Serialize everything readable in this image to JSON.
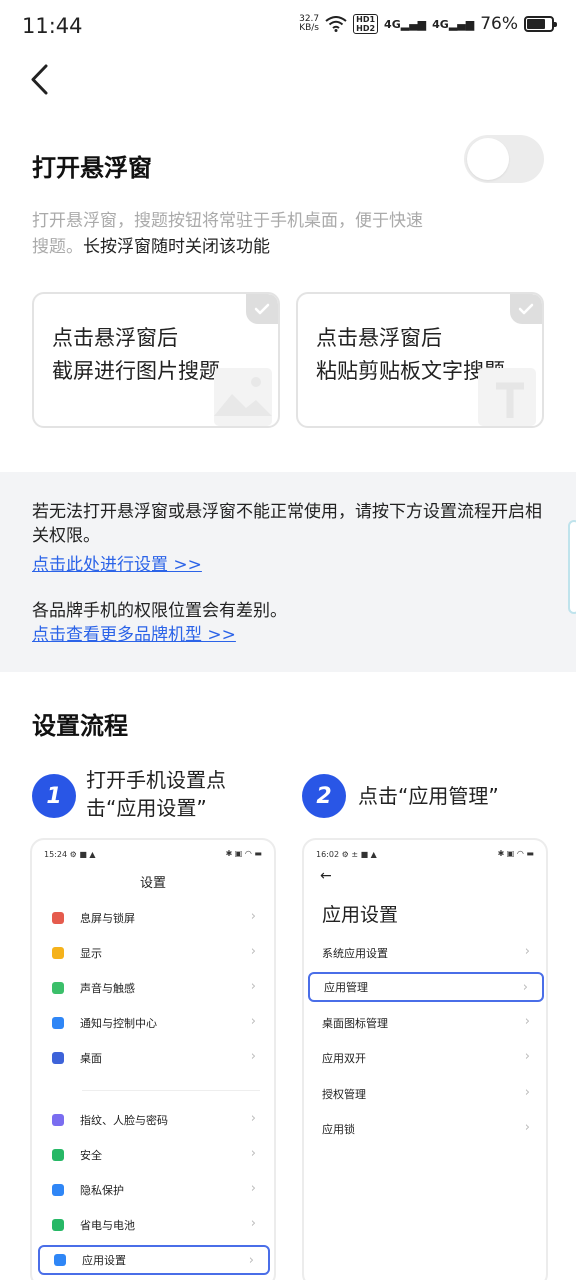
{
  "status": {
    "time": "11:44",
    "net_speed_value": "32.7",
    "net_speed_unit": "KB/s",
    "hd1": "HD1",
    "hd2": "HD2",
    "sig1": "4G",
    "sig2": "4G",
    "battery": "76%",
    "battery_level": 0.76
  },
  "floating": {
    "title": "打开悬浮窗",
    "toggle_on": false,
    "desc_part1": "打开悬浮窗，搜题按钮将常驻于手机桌面，便于快速搜题。",
    "desc_part2": "长按浮窗随时关闭该功能"
  },
  "modes": [
    {
      "line1": "点击悬浮窗后",
      "line2": "截屏进行图片搜题"
    },
    {
      "line1": "点击悬浮窗后",
      "line2": "粘贴剪贴板文字搜题"
    }
  ],
  "permission": {
    "text": "若无法打开悬浮窗或悬浮窗不能正常使用，请按下方设置流程开启相关权限。",
    "link1": "点击此处进行设置 >>",
    "brand_text": "各品牌手机的权限位置会有差别。",
    "link2": "点击查看更多品牌机型 >>"
  },
  "flow": {
    "title": "设置流程",
    "steps": [
      {
        "num": "1",
        "text": "打开手机设置点击“应用设置”"
      },
      {
        "num": "2",
        "text": "点击“应用管理”"
      }
    ]
  },
  "phone1": {
    "time": "15:24",
    "title": "设置",
    "items": [
      {
        "label": "息屏与锁屏",
        "color": "#e55b4d"
      },
      {
        "label": "显示",
        "color": "#f5b21b"
      },
      {
        "label": "声音与触感",
        "color": "#3bbf6a"
      },
      {
        "label": "通知与控制中心",
        "color": "#2f86f6"
      },
      {
        "label": "桌面",
        "color": "#3e63d9"
      },
      {
        "label": "指纹、人脸与密码",
        "color": "#7a6df0"
      },
      {
        "label": "安全",
        "color": "#27b866"
      },
      {
        "label": "隐私保护",
        "color": "#2f86f6"
      },
      {
        "label": "省电与电池",
        "color": "#27b866"
      },
      {
        "label": "应用设置",
        "color": "#2f86f6"
      }
    ]
  },
  "phone2": {
    "time": "16:02",
    "back": "←",
    "title": "应用设置",
    "items": [
      "系统应用设置",
      "应用管理",
      "桌面图标管理",
      "应用双开",
      "授权管理",
      "应用锁"
    ]
  },
  "arrow_glyph": "›"
}
